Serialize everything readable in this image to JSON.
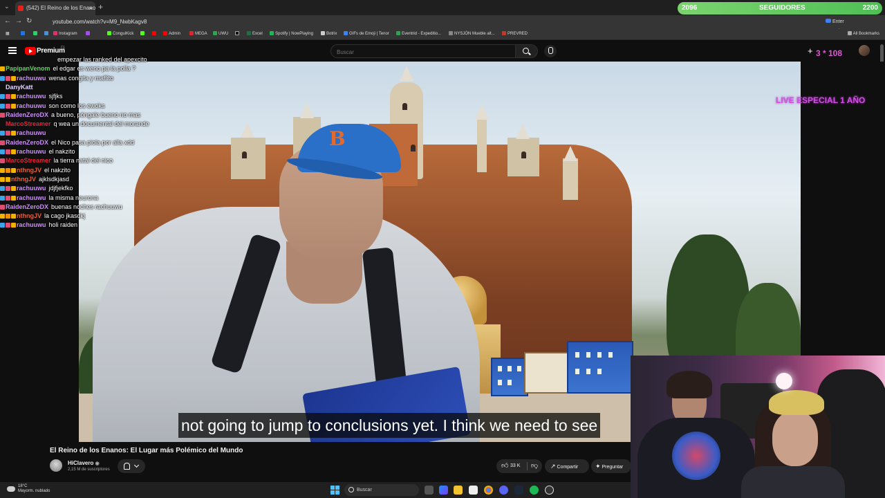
{
  "browser": {
    "tab_title": "(542) El Reino de los Enanos",
    "url": "youtube.com/watch?v=M9_NwbKagv8",
    "passphrase_button": "Enter passphrase",
    "bookmarks": [
      "Instagram",
      "ConguiKick",
      "Admin",
      "MEGA",
      "UWU",
      "Excel",
      "Spotify | NowPlaying",
      "Botrix",
      "GIFs de Emoji | Tenor",
      "Eventrid - Expeditio...",
      "NYSJÓN Mueble alt...",
      "PREVRED"
    ],
    "all_bookmarks": "All Bookmarks"
  },
  "overlay": {
    "followers_current": "2096",
    "followers_label": "SEGUIDORES",
    "followers_goal": "2200",
    "live_special": "LIVE ESPECIAL 1 AÑO",
    "pink_badge": "3 * 108"
  },
  "youtube": {
    "logo_text": "Premium",
    "country_code": "CL",
    "search_placeholder": "Buscar",
    "subtitle": "not going to jump to conclusions yet. I think we need to see",
    "video_title": "El Reino de los Enanos: El Lugar más Polémico del Mundo",
    "channel_name": "HiClavero",
    "channel_subs": "2,15 M de suscriptores",
    "likes": "33 K",
    "share_label": "Compartir",
    "ask_label": "Preguntar"
  },
  "chat": [
    {
      "user": "",
      "color": "#ffffff",
      "msg": "empezar las ranked del apexcito",
      "badges": []
    },
    {
      "user": "PapipanVenom",
      "color": "#5fd35f",
      "msg": "el edgar es weno pa la polla ?",
      "badges": [
        "#f0b400"
      ]
    },
    {
      "user": "rachuuwu",
      "color": "#c98ef5",
      "msg": "wenas congita y maflito",
      "badges": [
        "#3ba5e8",
        "#e04d73",
        "#f0b400"
      ]
    },
    {
      "user": "DanyKatt",
      "color": "#e3d3ff",
      "msg": "",
      "badges": []
    },
    {
      "user": "rachuuwu",
      "color": "#c98ef5",
      "msg": "sjfjks",
      "badges": [
        "#3ba5e8",
        "#e04d73",
        "#f0b400"
      ]
    },
    {
      "user": "rachuuwu",
      "color": "#c98ef5",
      "msg": "son como los ewoks",
      "badges": [
        "#3ba5e8",
        "#e04d73",
        "#f0b400"
      ]
    },
    {
      "user": "RaidenZeroDX",
      "color": "#c98ef5",
      "msg": "a bueno, póngale bueno no mas",
      "badges": [
        "#e04d73"
      ]
    },
    {
      "user": "MarcoStreamer",
      "color": "#e0243a",
      "msg": "q wea un documental del morande",
      "badges": []
    },
    {
      "user": "rachuuwu",
      "color": "#c98ef5",
      "msg": "",
      "badges": [
        "#3ba5e8",
        "#e04d73",
        "#f0b400"
      ]
    },
    {
      "user": "RaidenZeroDX",
      "color": "#c98ef5",
      "msg": "el Nico pasa piola por alla xdd",
      "badges": [
        "#e04d73"
      ]
    },
    {
      "user": "rachuuwu",
      "color": "#c98ef5",
      "msg": "el nakzito",
      "badges": [
        "#3ba5e8",
        "#e04d73",
        "#f0b400"
      ]
    },
    {
      "user": "MarcoStreamer",
      "color": "#e0243a",
      "msg": "la tierra natal del nico",
      "badges": [
        "#e04d73"
      ]
    },
    {
      "user": "nthngJV",
      "color": "#e85c3a",
      "msg": "el nakzito",
      "badges": [
        "#f0b400",
        "#f08c00",
        "#f0b400"
      ]
    },
    {
      "user": "nthngJV",
      "color": "#e85c3a",
      "msg": "ajklsdkjasd",
      "badges": [
        "#f0b400",
        "#f0b400"
      ]
    },
    {
      "user": "rachuuwu",
      "color": "#c98ef5",
      "msg": "jdjfjekfko",
      "badges": [
        "#3ba5e8",
        "#e04d73",
        "#f0b400"
      ]
    },
    {
      "user": "rachuuwu",
      "color": "#c98ef5",
      "msg": "la misma neurona",
      "badges": [
        "#3ba5e8",
        "#e04d73",
        "#f0b400"
      ]
    },
    {
      "user": "RaidenZeroDX",
      "color": "#c98ef5",
      "msg": "buenas noches rachuuwu",
      "badges": [
        "#e04d73"
      ]
    },
    {
      "user": "nthngJV",
      "color": "#e85c3a",
      "msg": "la cago jkasdkj",
      "badges": [
        "#f0b400",
        "#f08c00",
        "#f0b400"
      ]
    },
    {
      "user": "rachuuwu",
      "color": "#c98ef5",
      "msg": "holi raiden",
      "badges": [
        "#3ba5e8",
        "#e04d73",
        "#f0b400"
      ]
    }
  ],
  "taskbar": {
    "temperature": "18°C",
    "weather": "Mayorm. nublado",
    "search_label": "Buscar"
  }
}
